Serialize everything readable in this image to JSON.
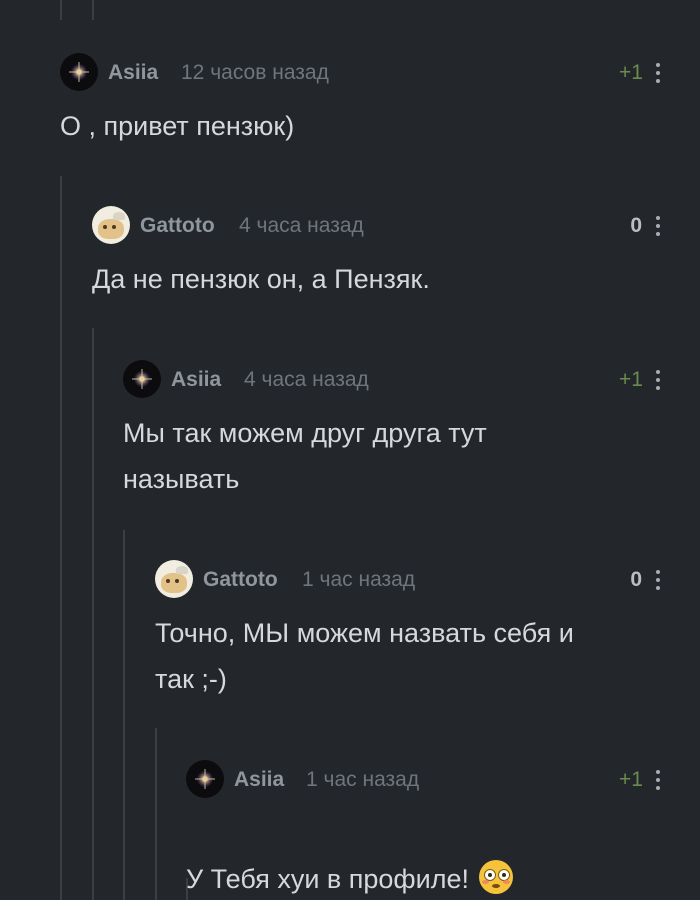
{
  "comments": [
    {
      "username": "Asiia",
      "time": "12 часов назад",
      "rating": "+1",
      "avatar": "dark-sparkle-avatar",
      "text": "О , привет пензюк)"
    },
    {
      "username": "Gattoto",
      "time": "4 часа назад",
      "rating": "0",
      "avatar": "cat-avatar",
      "text": "Да не пензюк он, а Пензяк."
    },
    {
      "username": "Asiia",
      "time": "4 часа назад",
      "rating": "+1",
      "avatar": "dark-sparkle-avatar",
      "text": "Мы так можем друг друга тут\nназывать"
    },
    {
      "username": "Gattoto",
      "time": "1 час назад",
      "rating": "0",
      "avatar": "cat-avatar",
      "text": "Точно, МЫ можем назвать себя и\nтак ;-)"
    },
    {
      "username": "Asiia",
      "time": "1 час назад",
      "rating": "+1",
      "avatar": "dark-sparkle-avatar",
      "text": "У Тебя хуи в профиле!",
      "emoji": "flushed-face-emoji"
    }
  ],
  "colors": {
    "background": "#23272b",
    "thread_line": "#3a3f44",
    "positive_rating": "#6b8c4e",
    "neutral_rating": "#b9bec2",
    "username": "#8f969c",
    "timestamp": "#6e757b",
    "comment_text": "#d6d9dc"
  },
  "icons": {
    "menu": "vertical-ellipsis-icon"
  }
}
